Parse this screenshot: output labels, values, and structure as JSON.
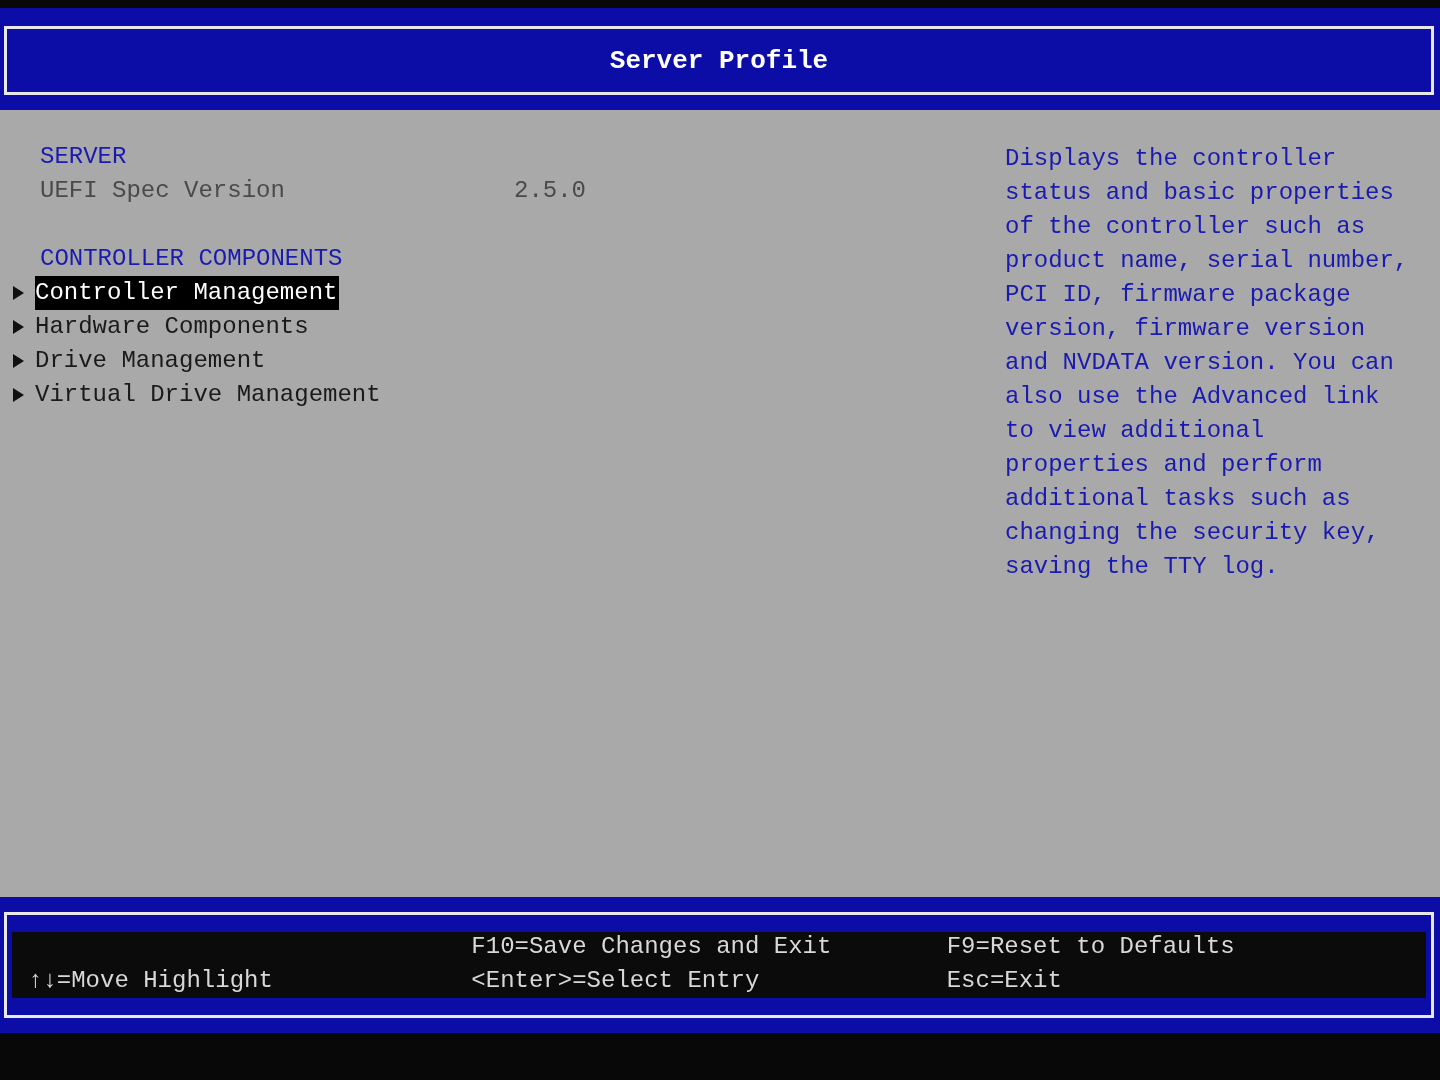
{
  "header": {
    "title": "Server Profile"
  },
  "sections": [
    {
      "heading": "SERVER",
      "fields": [
        {
          "label": "UEFI Spec Version",
          "value": "2.5.0"
        }
      ]
    },
    {
      "heading": "CONTROLLER COMPONENTS",
      "items": [
        {
          "label": "Controller Management",
          "selected": true
        },
        {
          "label": "Hardware Components",
          "selected": false
        },
        {
          "label": "Drive Management",
          "selected": false
        },
        {
          "label": "Virtual Drive Management",
          "selected": false
        }
      ]
    }
  ],
  "help": "Displays the controller status and basic properties of the controller such as product name, serial number, PCI ID, firmware package version, firmware version and NVDATA version. You can also use the Advanced link to view additional properties and perform additional tasks such as changing the security key, saving the TTY log.",
  "footer": {
    "columns": [
      {
        "lines": [
          "↑↓=Move Highlight"
        ]
      },
      {
        "lines": [
          "F10=Save Changes and Exit",
          "<Enter>=Select Entry"
        ]
      },
      {
        "lines": [
          "F9=Reset to Defaults",
          "Esc=Exit"
        ]
      }
    ]
  }
}
